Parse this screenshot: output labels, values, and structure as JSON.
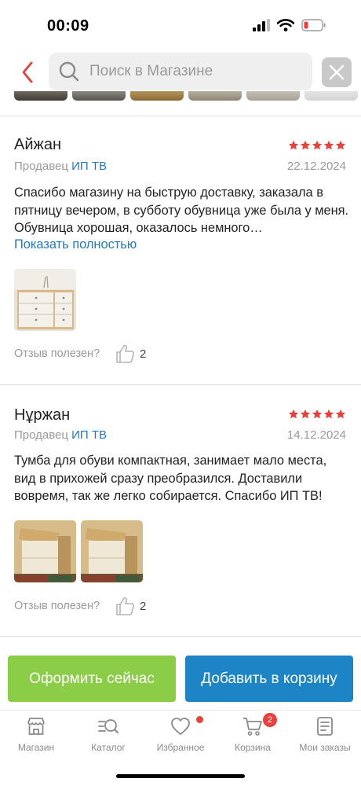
{
  "status_bar": {
    "time": "00:09"
  },
  "header": {
    "search_placeholder": "Поиск в Магазине"
  },
  "colors": {
    "star": "#e8403a",
    "link": "#1f7bc1",
    "checkout": "#8ccd47",
    "cart": "#1d84c6",
    "badge": "#e8403a"
  },
  "reviews": [
    {
      "name": "Айжан",
      "rating": 5,
      "seller_prefix": "Продавец",
      "seller_name": "ИП ТВ",
      "date": "22.12.2024",
      "text": "Спасибо магазину на быструю доставку, заказала в пятницу вечером, в субботу обувница уже была у меня. Обувница хорошая, оказалось немного…",
      "show_more": "Показать полностью",
      "photos": 1,
      "helpful_label": "Отзыв полезен?",
      "likes": "2"
    },
    {
      "name": "Нұржан",
      "rating": 5,
      "seller_prefix": "Продавец",
      "seller_name": "ИП ТВ",
      "date": "14.12.2024",
      "text": "Тумба для обуви компактная, занимает мало места, вид в прихожей сразу преобразился. Доставили вовремя, так же легко собирается. Спасибо ИП ТВ!",
      "photos": 2,
      "helpful_label": "Отзыв полезен?",
      "likes": "2"
    }
  ],
  "actions": {
    "checkout": "Оформить сейчас",
    "add_to_cart": "Добавить в корзину"
  },
  "tabs": [
    {
      "label": "Магазин",
      "icon": "shop-icon"
    },
    {
      "label": "Каталог",
      "icon": "catalog-search-icon"
    },
    {
      "label": "Избранное",
      "icon": "heart-icon"
    },
    {
      "label": "Корзина",
      "icon": "cart-icon",
      "badge": "2"
    },
    {
      "label": "Мои заказы",
      "icon": "orders-list-icon"
    }
  ]
}
